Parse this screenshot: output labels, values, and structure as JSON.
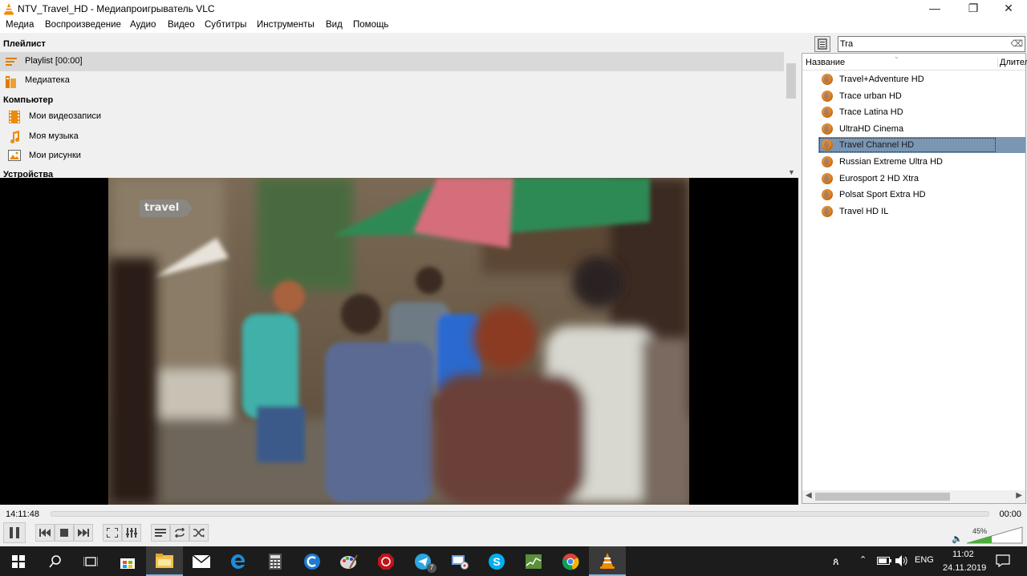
{
  "window": {
    "title": "NTV_Travel_HD - Медиапроигрыватель VLC",
    "minimize_glyph": "—",
    "maximize_glyph": "❐",
    "close_glyph": "✕"
  },
  "menu": [
    "Медиа",
    "Воспроизведение",
    "Аудио",
    "Видео",
    "Субтитры",
    "Инструменты",
    "Вид",
    "Помощь"
  ],
  "sidebar": {
    "playlist_header": "Плейлист",
    "playlist_item": "Playlist [00:00]",
    "library_item": "Медиатека",
    "computer_header": "Компьютер",
    "computer_items": [
      "Мои видеозаписи",
      "Моя музыка",
      "Мои рисунки"
    ],
    "devices_header": "Устройства"
  },
  "video": {
    "channel_logo": "travel"
  },
  "playlist": {
    "search_value": "Tra",
    "search_clear_glyph": "⌫",
    "columns": [
      "Название",
      "Длител"
    ],
    "items": [
      {
        "name": "Travel+Adventure HD"
      },
      {
        "name": "Trace urban HD"
      },
      {
        "name": "Trace Latina HD"
      },
      {
        "name": "UltraHD Cinema"
      },
      {
        "name": "Travel Channel HD"
      },
      {
        "name": "Russian Extreme Ultra HD"
      },
      {
        "name": "Eurosport 2 HD Xtra"
      },
      {
        "name": "Polsat Sport Extra HD"
      },
      {
        "name": "Travel HD IL"
      }
    ],
    "selected_index": 4
  },
  "seekbar": {
    "elapsed": "14:11:48",
    "remaining": "00:00"
  },
  "volume": {
    "label": "45%",
    "level": 0.45
  },
  "taskbar": {
    "apps": [
      "start-icon",
      "search-icon",
      "task-view-icon",
      "store-icon",
      "file-explorer-icon",
      "mail-icon",
      "edge-icon",
      "calculator-icon",
      "ccleaner-icon",
      "paint-icon",
      "stop-icon",
      "telegram-icon",
      "network-icon",
      "skype-icon",
      "task-manager-icon",
      "chrome-icon",
      "vlc-icon"
    ],
    "telegram_badge": "7",
    "language": "ENG",
    "time": "11:02",
    "date": "24.11.2019"
  },
  "colors": {
    "selection": "#7a96b3",
    "vlc_orange": "#f08c00",
    "taskbar_bg": "#1c1c1c",
    "volume_green": "#4caf3a"
  }
}
